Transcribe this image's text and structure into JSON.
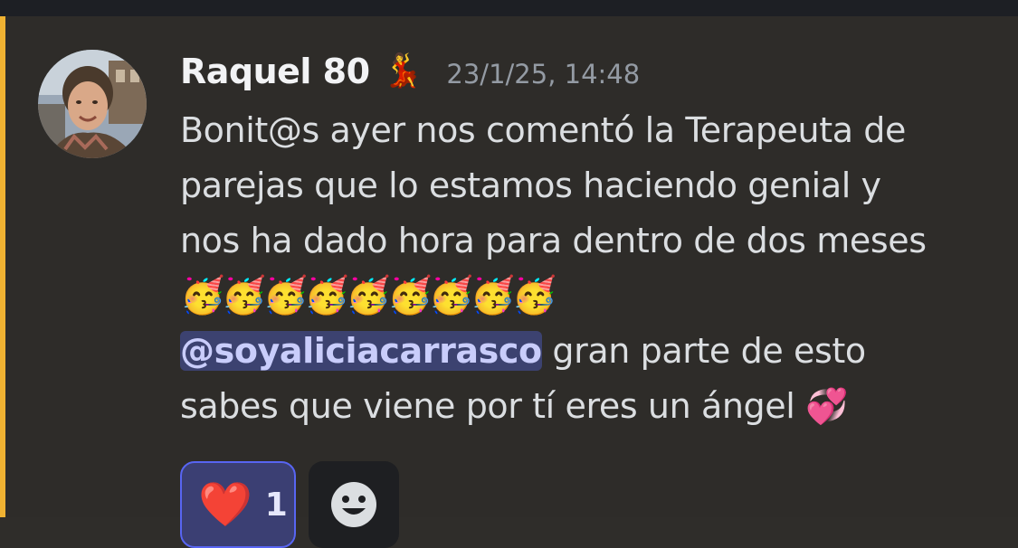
{
  "message": {
    "author": "Raquel 80",
    "author_emoji": "💃",
    "timestamp": "23/1/25, 14:48",
    "lines": [
      "Bonit@s ayer nos comentó la Terapeuta de",
      "parejas que  lo estamos haciendo genial y",
      "nos ha dado hora para dentro de dos meses",
      "🥳🥳🥳🥳🥳🥳🥳🥳🥳"
    ],
    "mention": "@soyaliciacarrasco",
    "after_mention": " gran parte de esto",
    "last_line": "sabes que viene por tí eres un ángel 💞"
  },
  "reactions": [
    {
      "emoji": "❤️",
      "count": "1"
    }
  ],
  "colors": {
    "background": "#2e2c29",
    "highlight": "#f0b232",
    "mention_bg": "#3c4270",
    "reaction_border": "#5865f2"
  },
  "icons": {
    "add_reaction": "smiley-icon"
  }
}
